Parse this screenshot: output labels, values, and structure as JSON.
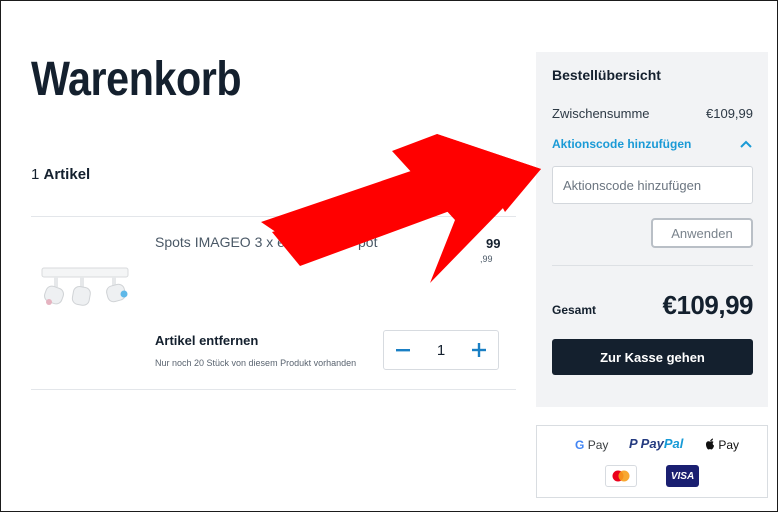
{
  "cart": {
    "title": "Warenkorb",
    "item_count_number": "1",
    "item_count_label": "Artikel",
    "items": [
      {
        "name": "Spots IMAGEO 3 x eins",
        "name_tail": "pot",
        "price": "99",
        "price_old": ",99",
        "remove_label": "Artikel entfernen",
        "stock_note": "Nur noch 20 Stück von diesem Produkt vorhanden",
        "quantity": "1"
      }
    ]
  },
  "summary": {
    "title": "Bestellübersicht",
    "subtotal_label": "Zwischensumme",
    "subtotal_value": "€109,99",
    "promo_toggle_label": "Aktionscode hinzufügen",
    "promo_input_placeholder": "Aktionscode hinzufügen",
    "promo_input_value": "",
    "apply_label": "Anwenden",
    "total_label": "Gesamt",
    "total_value": "€109,99",
    "checkout_label": "Zur Kasse gehen"
  },
  "payments": {
    "gpay_g": "G",
    "gpay_text": "Pay",
    "paypal_pay": "Pay",
    "paypal_pal": "Pal",
    "paypal_icon": "P",
    "applepay_text": "Pay",
    "visa_text": "VISA"
  },
  "colors": {
    "primary_dark": "#14202e",
    "accent_blue": "#1a9ad6",
    "annotation_red": "#ff0000",
    "summary_bg": "#f2f3f5"
  },
  "icons": {
    "qty_minus": "minus-icon",
    "qty_plus": "plus-icon",
    "promo_chevron": "chevron-up-icon",
    "annotation": "red-arrow-icon"
  }
}
